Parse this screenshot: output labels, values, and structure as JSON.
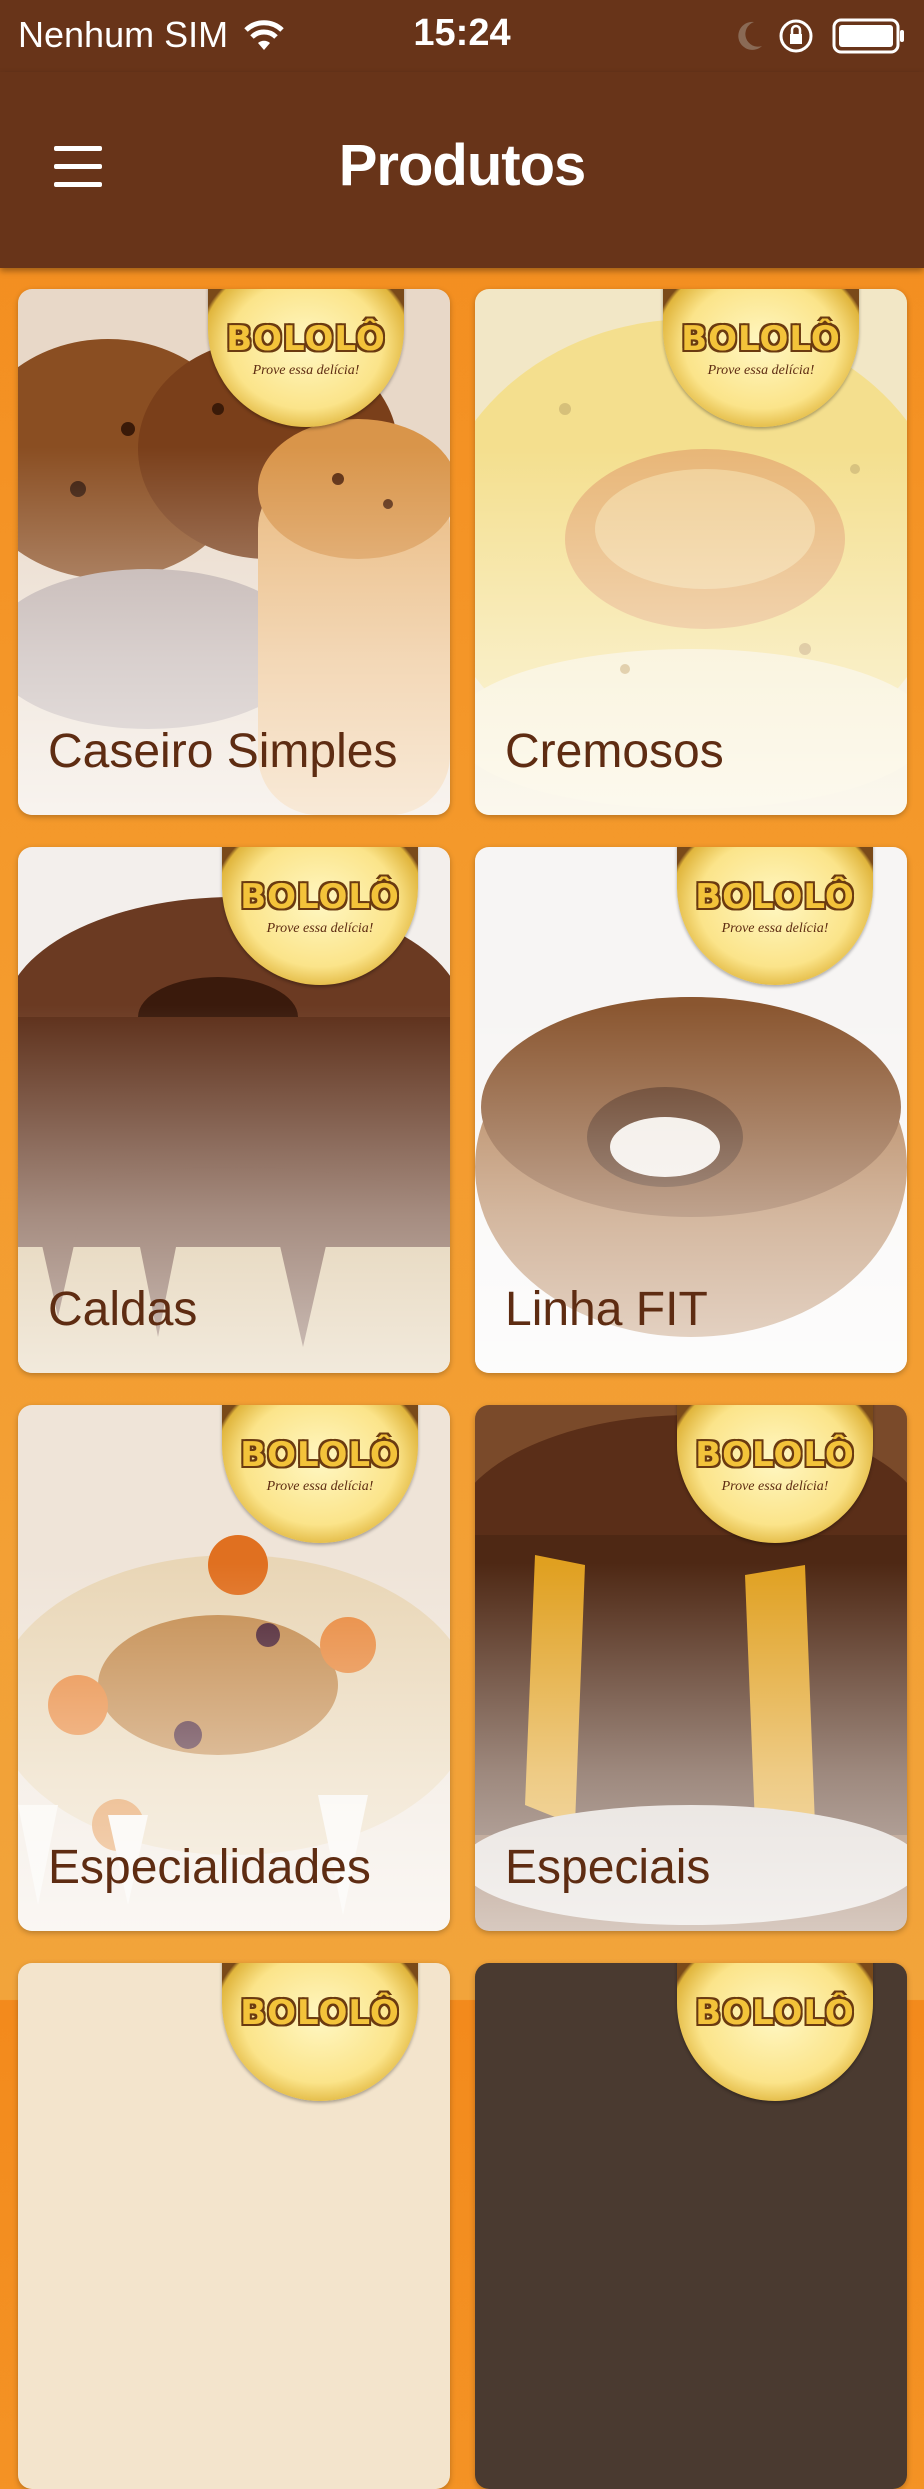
{
  "status_bar": {
    "carrier": "Nenhum SIM",
    "time": "15:24",
    "icons": [
      "wifi-icon",
      "moon-icon",
      "orientation-lock-icon",
      "battery-icon"
    ]
  },
  "nav": {
    "title": "Produtos",
    "menu_icon": "hamburger-menu-icon"
  },
  "brand": {
    "name": "BOLOLÔ",
    "slogan": "Prove essa delícia!"
  },
  "categories": [
    {
      "label": "Caseiro Simples"
    },
    {
      "label": "Cremosos"
    },
    {
      "label": "Caldas"
    },
    {
      "label": "Linha FIT"
    },
    {
      "label": "Especialidades"
    },
    {
      "label": "Especiais"
    }
  ],
  "colors": {
    "header": "#683419",
    "background_top": "#f38a1c",
    "background_bottom": "#f2a43b",
    "label_text": "#5e2c12"
  }
}
